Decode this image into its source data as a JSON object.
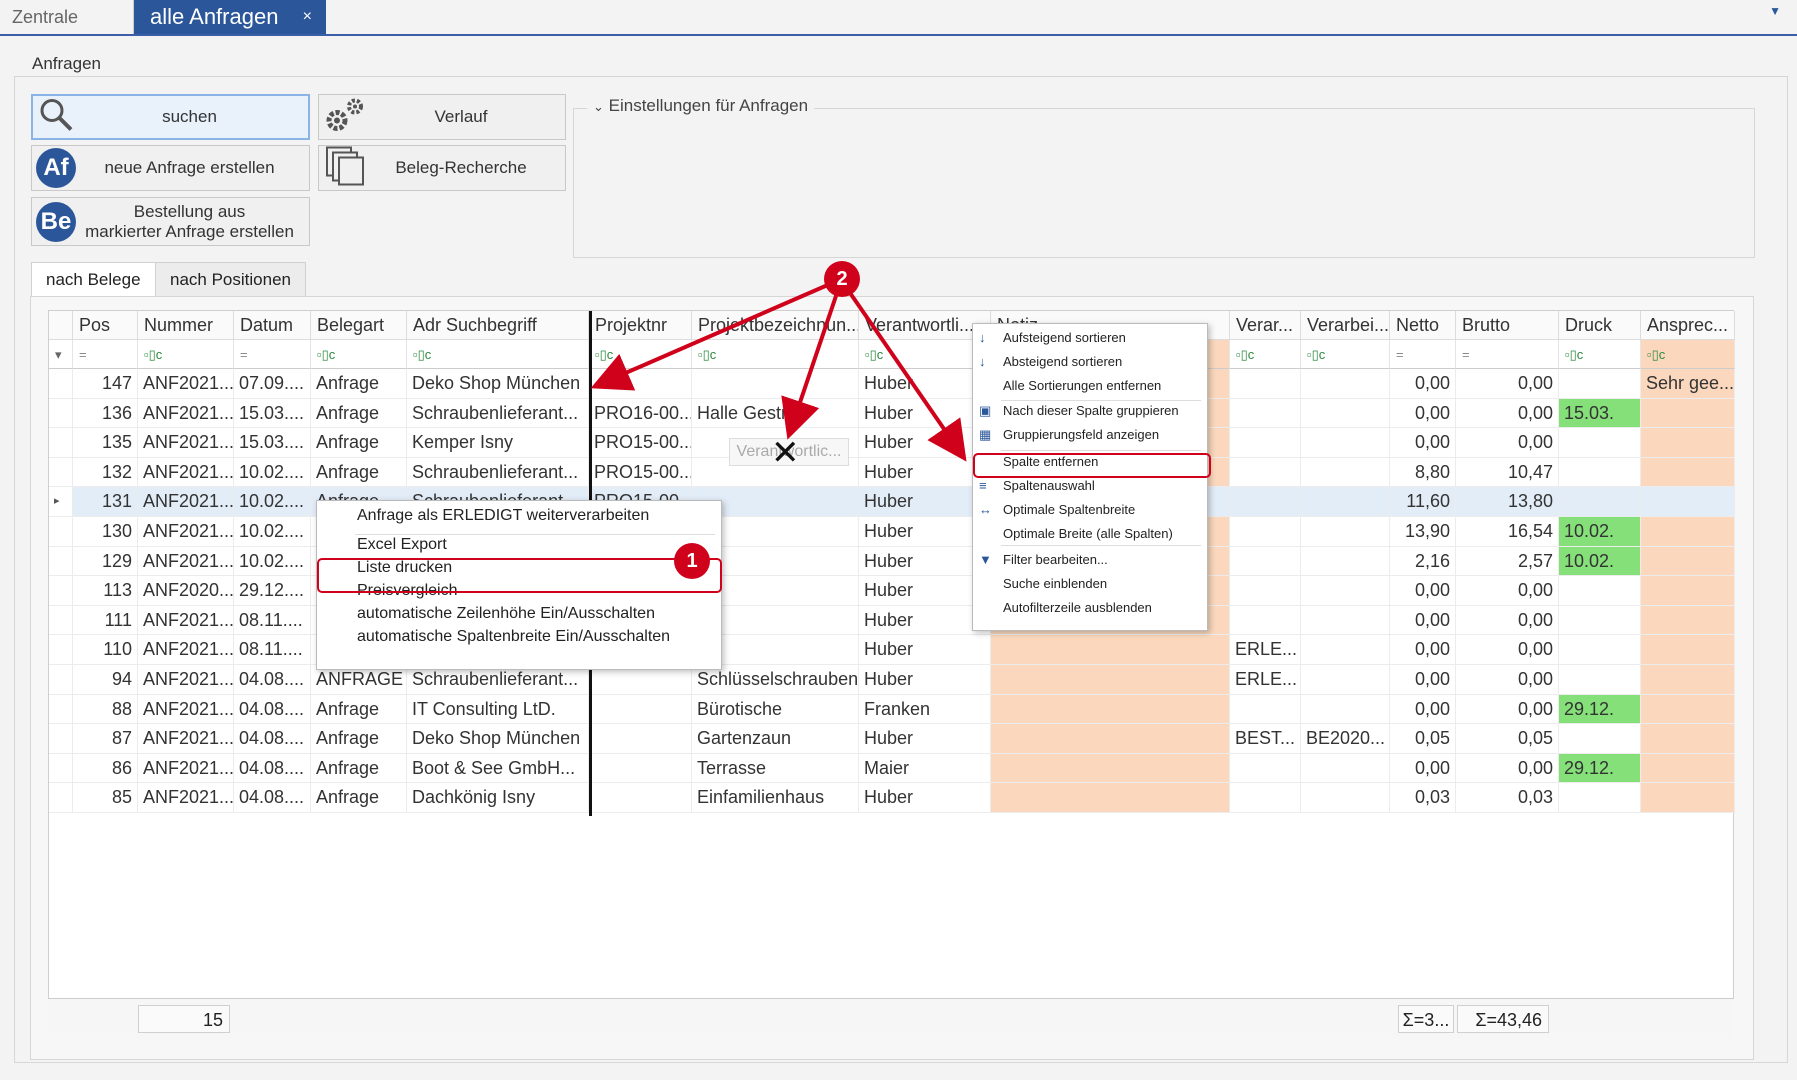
{
  "tabs": {
    "inactive": "Zentrale",
    "active": "alle Anfragen",
    "close": "×"
  },
  "group_title": "Anfragen",
  "buttons": {
    "search": "suchen",
    "history": "Verlauf",
    "new_request": "neue Anfrage erstellen",
    "doc_research": "Beleg-Recherche",
    "order_line1": "Bestellung aus",
    "order_line2": "markierter Anfrage erstellen",
    "af_icon": "Af",
    "be_icon": "Be"
  },
  "settings_title": "Einstellungen für Anfragen",
  "subtabs": [
    "nach Belege",
    "nach Positionen"
  ],
  "columns": [
    "Pos",
    "Nummer",
    "Datum",
    "Belegart",
    "Adr Suchbegriff",
    "Projektnr",
    "Projektbezeichnun...",
    "Verantwortli...",
    "Notiz",
    "Verar...",
    "Verarbei...",
    "Netto",
    "Brutto",
    "Druck",
    "Ansprec..."
  ],
  "rows": [
    [
      "147",
      "ANF2021...",
      "07.09....",
      "Anfrage",
      "Deko Shop München",
      "",
      "",
      "Huber",
      "",
      "",
      "",
      "0,00",
      "0,00",
      "",
      "Sehr gee..."
    ],
    [
      "136",
      "ANF2021...",
      "15.03....",
      "Anfrage",
      "Schraubenlieferant...",
      "PRO16-00...",
      "Halle Gestrat",
      "Huber",
      "",
      "",
      "",
      "0,00",
      "0,00",
      "15.03.",
      ""
    ],
    [
      "135",
      "ANF2021...",
      "15.03....",
      "Anfrage",
      "Kemper Isny",
      "PRO15-00...",
      "",
      "Huber",
      "",
      "",
      "",
      "0,00",
      "0,00",
      "",
      ""
    ],
    [
      "132",
      "ANF2021...",
      "10.02....",
      "Anfrage",
      "Schraubenlieferant...",
      "PRO15-00...",
      "",
      "Huber",
      "",
      "",
      "",
      "8,80",
      "10,47",
      "",
      ""
    ],
    [
      "131",
      "ANF2021...",
      "10.02....",
      "Anfrage",
      "Schraubenlieferant...",
      "PRO15-00...",
      "",
      "Huber",
      "",
      "",
      "",
      "11,60",
      "13,80",
      "",
      ""
    ],
    [
      "130",
      "ANF2021...",
      "10.02....",
      "",
      "",
      "",
      "",
      "Huber",
      "",
      "",
      "",
      "13,90",
      "16,54",
      "10.02.",
      ""
    ],
    [
      "129",
      "ANF2021...",
      "10.02....",
      "",
      "",
      "",
      "",
      "Huber",
      "",
      "",
      "",
      "2,16",
      "2,57",
      "10.02.",
      ""
    ],
    [
      "113",
      "ANF2020...",
      "29.12....",
      "",
      "",
      "",
      "",
      "Huber",
      "",
      "",
      "",
      "0,00",
      "0,00",
      "",
      ""
    ],
    [
      "111",
      "ANF2021...",
      "08.11....",
      "",
      "",
      "",
      "",
      "Huber",
      "",
      "",
      "",
      "0,00",
      "0,00",
      "",
      ""
    ],
    [
      "110",
      "ANF2021...",
      "08.11....",
      "",
      "",
      "",
      "",
      "Huber",
      "",
      "ERLE...",
      "",
      "0,00",
      "0,00",
      "",
      ""
    ],
    [
      "94",
      "ANF2021...",
      "04.08....",
      "ANFRAGE",
      "Schraubenlieferant...",
      "",
      "Schlüsselschrauben",
      "Huber",
      "",
      "ERLE...",
      "",
      "0,00",
      "0,00",
      "",
      ""
    ],
    [
      "88",
      "ANF2021...",
      "04.08....",
      "Anfrage",
      "IT Consulting LtD.",
      "",
      "Bürotische",
      "Franken",
      "",
      "",
      "",
      "0,00",
      "0,00",
      "29.12.",
      ""
    ],
    [
      "87",
      "ANF2021...",
      "04.08....",
      "Anfrage",
      "Deko Shop München",
      "",
      "Gartenzaun",
      "Huber",
      "",
      "BEST...",
      "BE2020...",
      "0,05",
      "0,05",
      "",
      ""
    ],
    [
      "86",
      "ANF2021...",
      "04.08....",
      "Anfrage",
      "Boot & See GmbH...",
      "",
      "Terrasse",
      "Maier",
      "",
      "",
      "",
      "0,00",
      "0,00",
      "29.12.",
      ""
    ],
    [
      "85",
      "ANF2021...",
      "04.08....",
      "Anfrage",
      "Dachkönig Isny",
      "",
      "Einfamilienhaus",
      "Huber",
      "",
      "",
      "",
      "0,03",
      "0,03",
      "",
      ""
    ]
  ],
  "footer": {
    "count": "15",
    "netto_sum": "Σ=3...",
    "brutto_sum": "Σ=43,46"
  },
  "drag_ghost": "Verantwortlic...",
  "row_menu": [
    "Anfrage als ERLEDIGT weiterverarbeiten",
    "Excel Export",
    "Liste drucken",
    "Preisvergleich",
    "automatische Zeilenhöhe Ein/Ausschalten",
    "automatische Spaltenbreite Ein/Ausschalten"
  ],
  "column_menu": [
    "Aufsteigend sortieren",
    "Absteigend sortieren",
    "Alle Sortierungen entfernen",
    "Nach dieser Spalte gruppieren",
    "Gruppierungsfeld anzeigen",
    "Spalte entfernen",
    "Spaltenauswahl",
    "Optimale Spaltenbreite",
    "Optimale Breite (alle Spalten)",
    "Filter bearbeiten...",
    "Suche einblenden",
    "Autofilterzeile ausblenden"
  ],
  "annotations": {
    "badge1": "1",
    "badge2": "2"
  },
  "colors": {
    "accent": "#2b579a",
    "highlight_red": "#d0021b",
    "peach": "#fbd8bd",
    "green": "#86e07a"
  }
}
